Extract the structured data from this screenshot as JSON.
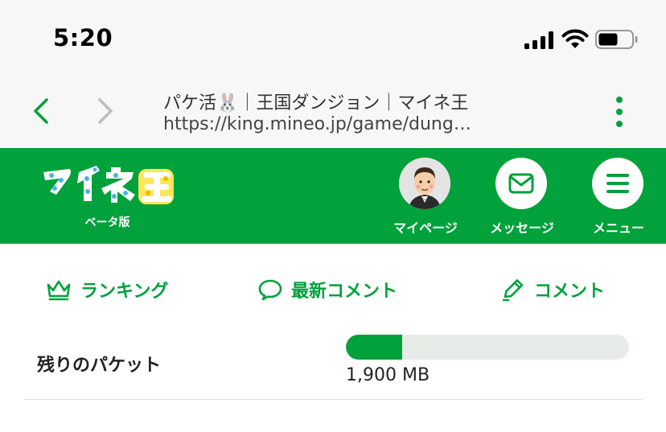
{
  "status_bar": {
    "time": "5:20"
  },
  "browser": {
    "title": "パケ活🐰｜王国ダンジョン｜マイネ王",
    "url": "https://king.mineo.jp/game/dung…"
  },
  "header": {
    "logo_text": "マイネ王",
    "logo_sub": "ベータ版",
    "buttons": [
      {
        "label": "マイページ",
        "icon": "avatar"
      },
      {
        "label": "メッセージ",
        "icon": "envelope-icon"
      },
      {
        "label": "メニュー",
        "icon": "hamburger-icon"
      }
    ]
  },
  "tabs": [
    {
      "label": "ランキング",
      "icon": "crown-icon"
    },
    {
      "label": "最新コメント",
      "icon": "speech-bubble-icon"
    },
    {
      "label": "コメント",
      "icon": "pencil-icon"
    }
  ],
  "packet": {
    "label": "残りのパケット",
    "value": "1,900 MB",
    "fill_fraction": 0.2
  },
  "colors": {
    "brand": "#01a13b",
    "track": "#e8ece9"
  }
}
